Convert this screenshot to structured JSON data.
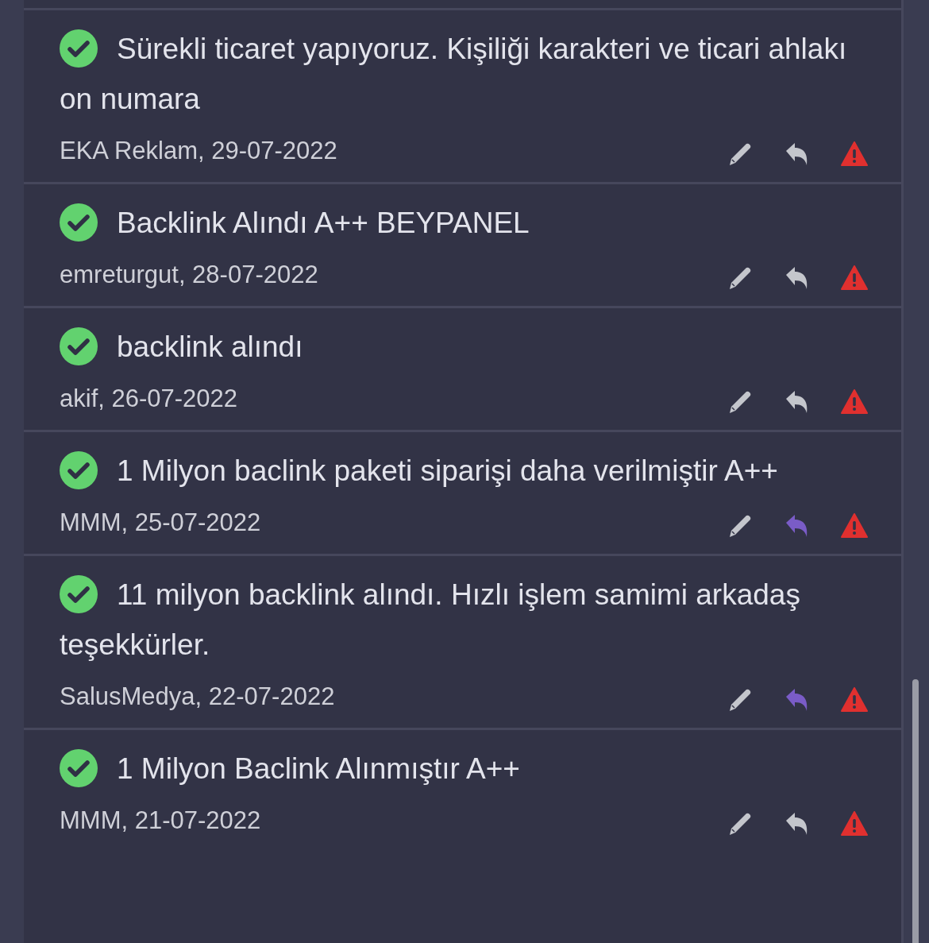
{
  "reviews": [
    {
      "approved": true,
      "text": "Sürekli ticaret yapıyoruz. Kişiliği karakteri ve ticari ahlakı on numara",
      "author_date": "EKA Reklam, 29-07-2022",
      "replied": false
    },
    {
      "approved": true,
      "text": "Backlink Alındı A++ BEYPANEL",
      "author_date": "emreturgut, 28-07-2022",
      "replied": false
    },
    {
      "approved": true,
      "text": "backlink alındı",
      "author_date": "akif, 26-07-2022",
      "replied": false
    },
    {
      "approved": true,
      "text": "1 Milyon baclink paketi siparişi daha verilmiştir A++",
      "author_date": "MMM, 25-07-2022",
      "replied": true
    },
    {
      "approved": true,
      "text": "11 milyon backlink alındı. Hızlı işlem samimi arkadaş teşekkürler.",
      "author_date": "SalusMedya, 22-07-2022",
      "replied": true
    },
    {
      "approved": true,
      "text": "1 Milyon Baclink Alınmıştır A++",
      "author_date": "MMM, 21-07-2022",
      "replied": false
    }
  ]
}
